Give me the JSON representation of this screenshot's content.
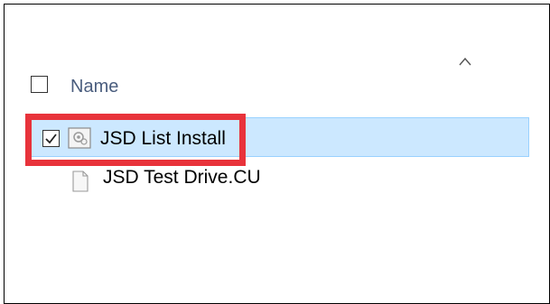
{
  "header": {
    "column_name": "Name",
    "sort_icon": "chevron-up-icon"
  },
  "rows": [
    {
      "label": "JSD List Install",
      "checked": true,
      "selected": true,
      "icon": "settings-file-icon"
    },
    {
      "label": "JSD Test Drive.CU",
      "checked": false,
      "selected": false,
      "icon": "blank-file-icon"
    }
  ],
  "colors": {
    "selection_background": "#cce8ff",
    "selection_border": "#99d1ff",
    "highlight_annotation": "#e8333b",
    "header_text": "#4a5d7e"
  }
}
